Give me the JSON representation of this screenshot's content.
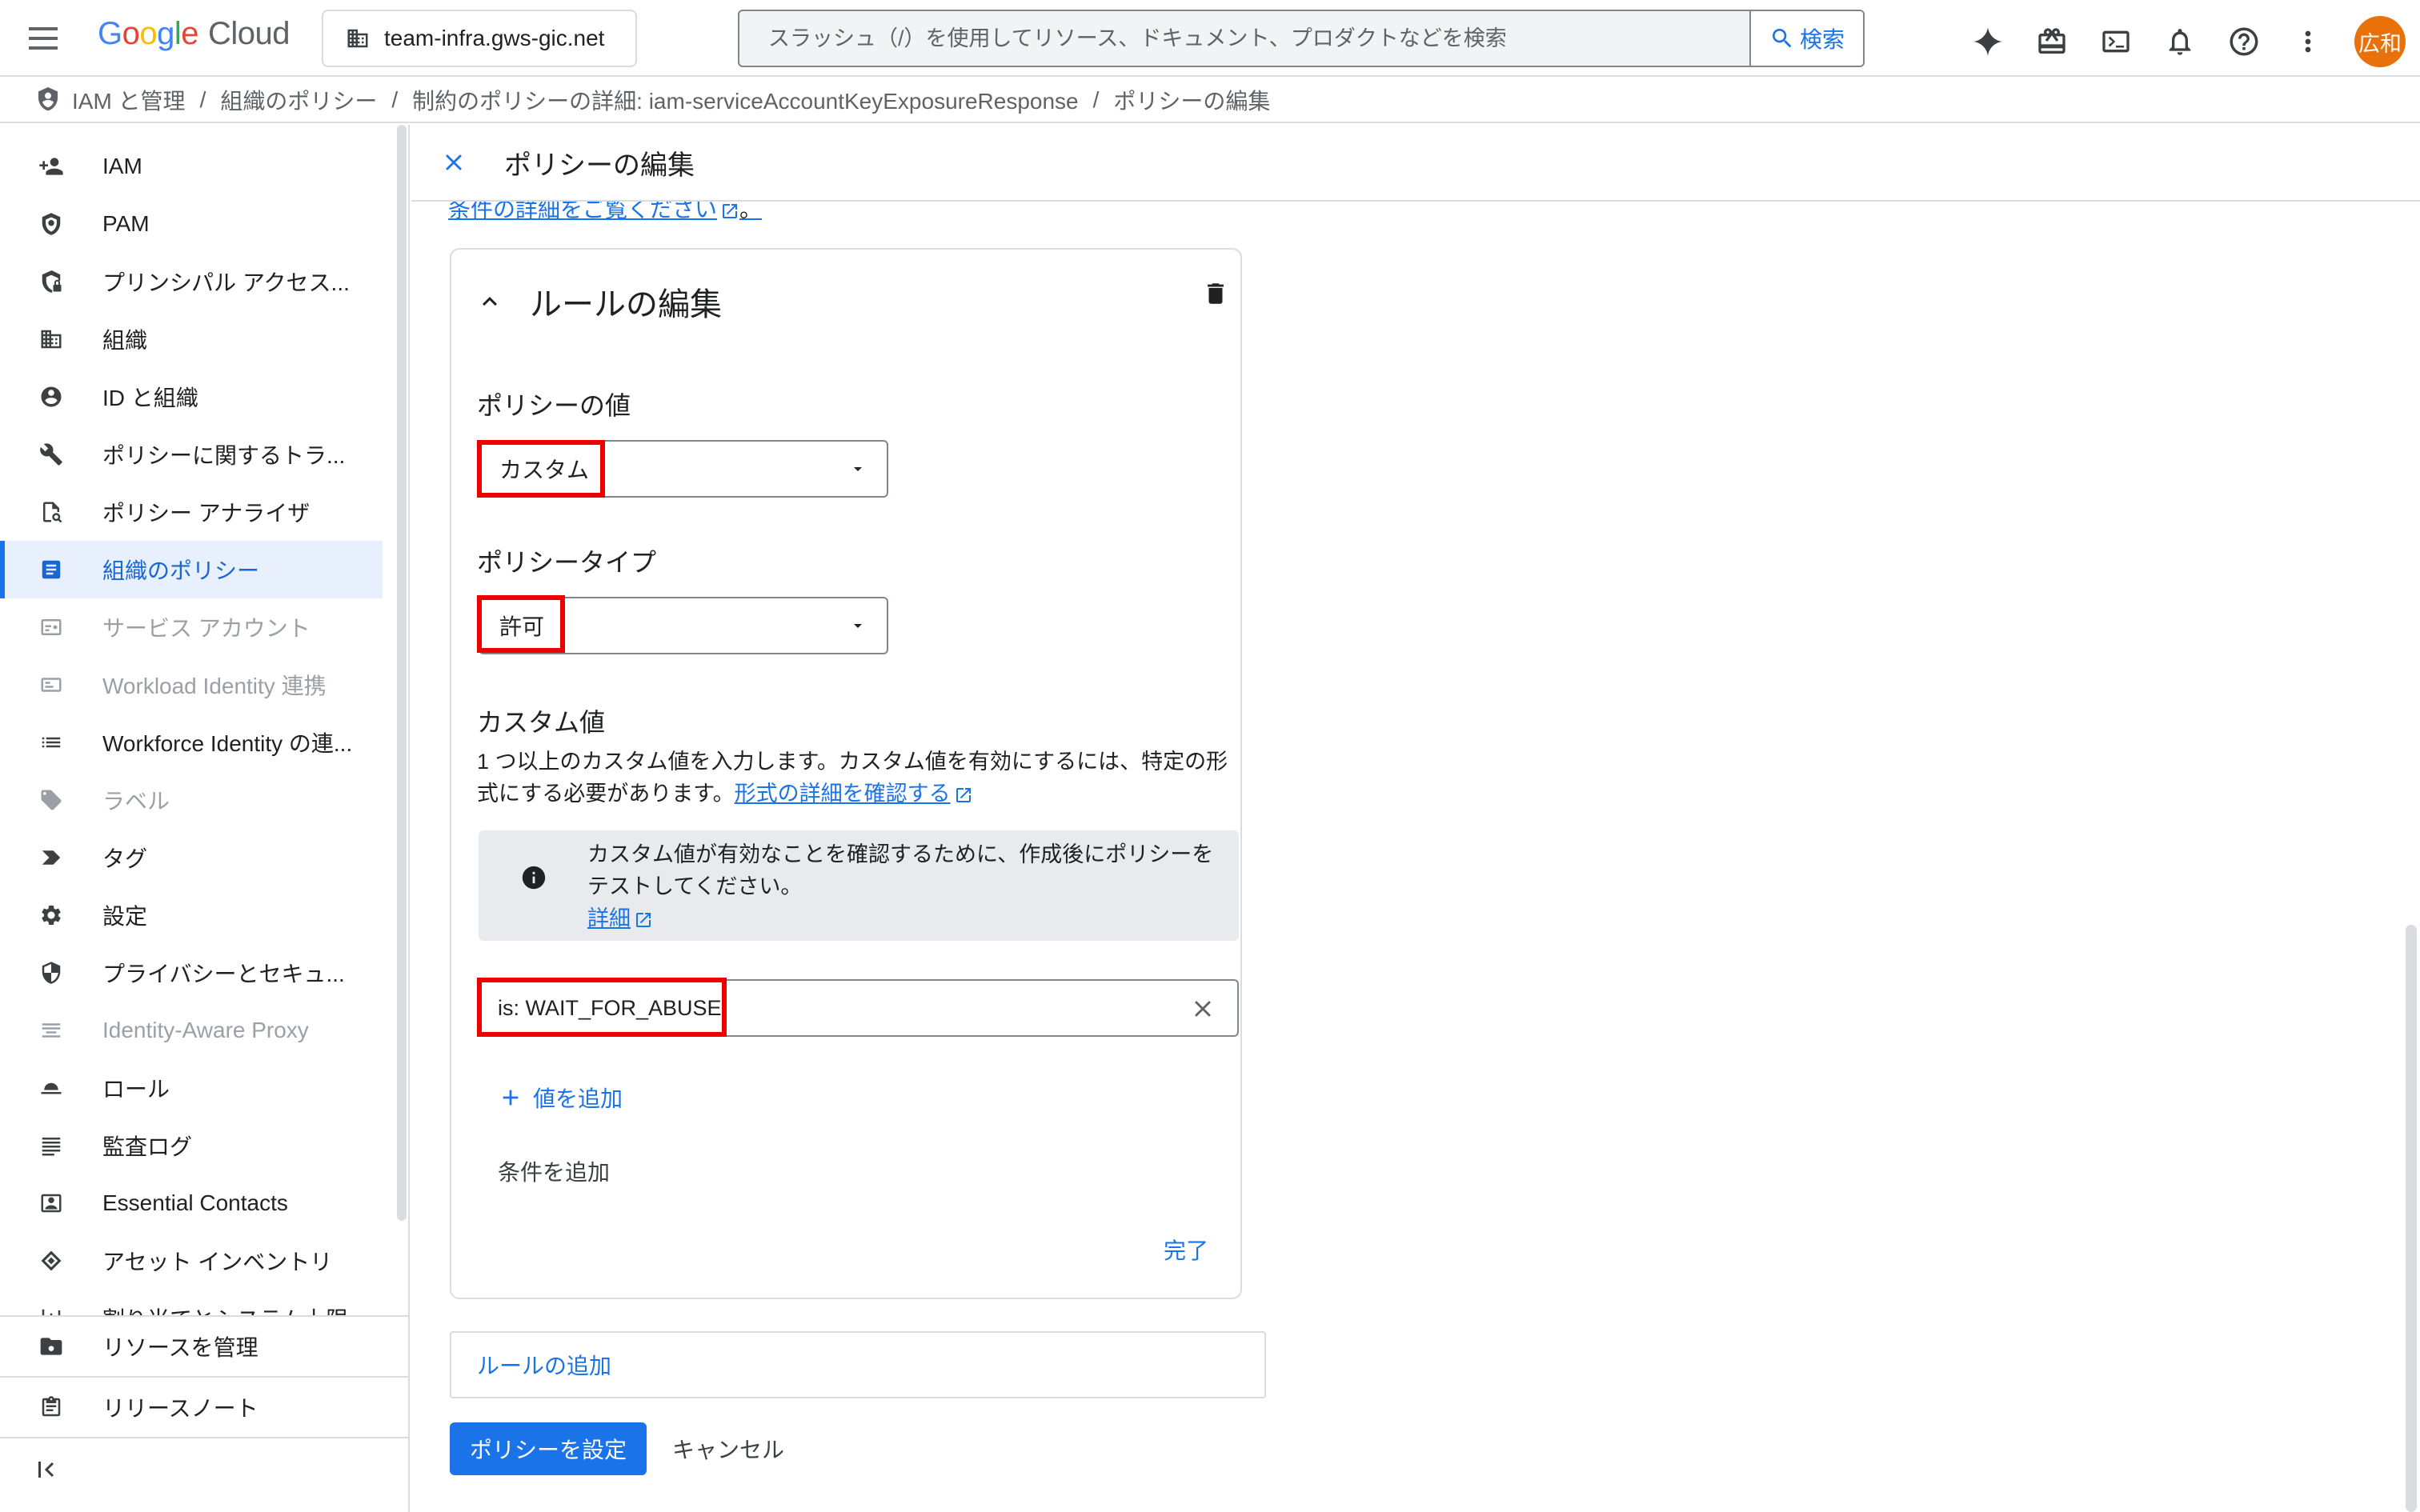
{
  "header": {
    "logo_parts": [
      "G",
      "o",
      "o",
      "g",
      "l",
      "e"
    ],
    "logo_product": "Cloud",
    "project": "team-infra.gws-gic.net",
    "search_placeholder": "スラッシュ（/）を使用してリソース、ドキュメント、プロダクトなどを検索",
    "search_button": "検索",
    "icons": [
      "gemini-icon",
      "gift-icon",
      "cloud-shell-icon",
      "notifications-icon",
      "help-icon",
      "more-vert-icon"
    ],
    "avatar": "広和",
    "avatar_color": "#e8710a"
  },
  "breadcrumb": [
    "IAM と管理",
    "組織のポリシー",
    "制約のポリシーの詳細: iam-serviceAccountKeyExposureResponse",
    "ポリシーの編集"
  ],
  "sidebar": {
    "items": [
      {
        "label": "IAM",
        "icon": "person-add-icon",
        "state": "normal"
      },
      {
        "label": "PAM",
        "icon": "shield-icon",
        "state": "normal"
      },
      {
        "label": "プリンシパル アクセス...",
        "icon": "shield-lock-icon",
        "state": "normal"
      },
      {
        "label": "組織",
        "icon": "domain-icon",
        "state": "normal"
      },
      {
        "label": "ID と組織",
        "icon": "account-circle-icon",
        "state": "normal"
      },
      {
        "label": "ポリシーに関するトラ...",
        "icon": "wrench-icon",
        "state": "normal"
      },
      {
        "label": "ポリシー アナライザ",
        "icon": "policy-analyzer-icon",
        "state": "normal"
      },
      {
        "label": "組織のポリシー",
        "icon": "list-alt-icon",
        "state": "active"
      },
      {
        "label": "サービス アカウント",
        "icon": "service-account-icon",
        "state": "disabled"
      },
      {
        "label": "Workload Identity 連携",
        "icon": "id-card-icon",
        "state": "disabled"
      },
      {
        "label": "Workforce Identity の連...",
        "icon": "list-icon",
        "state": "normal"
      },
      {
        "label": "ラベル",
        "icon": "label-icon",
        "state": "disabled"
      },
      {
        "label": "タグ",
        "icon": "tag-icon",
        "state": "normal"
      },
      {
        "label": "設定",
        "icon": "settings-icon",
        "state": "normal"
      },
      {
        "label": "プライバシーとセキュ...",
        "icon": "privacy-icon",
        "state": "normal"
      },
      {
        "label": "Identity-Aware Proxy",
        "icon": "iap-icon",
        "state": "disabled"
      },
      {
        "label": "ロール",
        "icon": "hat-icon",
        "state": "normal"
      },
      {
        "label": "監査ログ",
        "icon": "audit-log-icon",
        "state": "normal"
      },
      {
        "label": "Essential Contacts",
        "icon": "contacts-icon",
        "state": "normal"
      },
      {
        "label": "アセット インベントリ",
        "icon": "asset-inventory-icon",
        "state": "normal"
      },
      {
        "label": "割り当てとシステム上限",
        "icon": "quota-icon",
        "state": "normal"
      }
    ],
    "bottom": [
      {
        "label": "リソースを管理",
        "icon": "manage-resources-icon"
      },
      {
        "label": "リリースノート",
        "icon": "release-notes-icon"
      }
    ]
  },
  "panel": {
    "title": "ポリシーの編集",
    "top_link": "条件の詳細をご覧ください",
    "top_link_suffix": "。",
    "rule": {
      "title": "ルールの編集",
      "policy_value_label": "ポリシーの値",
      "policy_value": "カスタム",
      "policy_type_label": "ポリシータイプ",
      "policy_type": "許可",
      "custom_values_label": "カスタム値",
      "custom_values_desc": "1 つ以上のカスタム値を入力します。カスタム値を有効にするには、特定の形式にする必要があります。",
      "custom_values_link": "形式の詳細を確認する",
      "info_text": "カスタム値が有効なことを確認するために、作成後にポリシーをテストしてください。",
      "info_link": "詳細",
      "value_input": "is: WAIT_FOR_ABUSE",
      "add_value": "値を追加",
      "add_condition": "条件を追加",
      "done": "完了"
    },
    "add_rule": "ルールの追加",
    "set_policy": "ポリシーを設定",
    "cancel": "キャンセル"
  },
  "colors": {
    "accent": "#1a73e8",
    "highlight": "#ee0000",
    "active_nav_bg": "#e8f0fe"
  }
}
